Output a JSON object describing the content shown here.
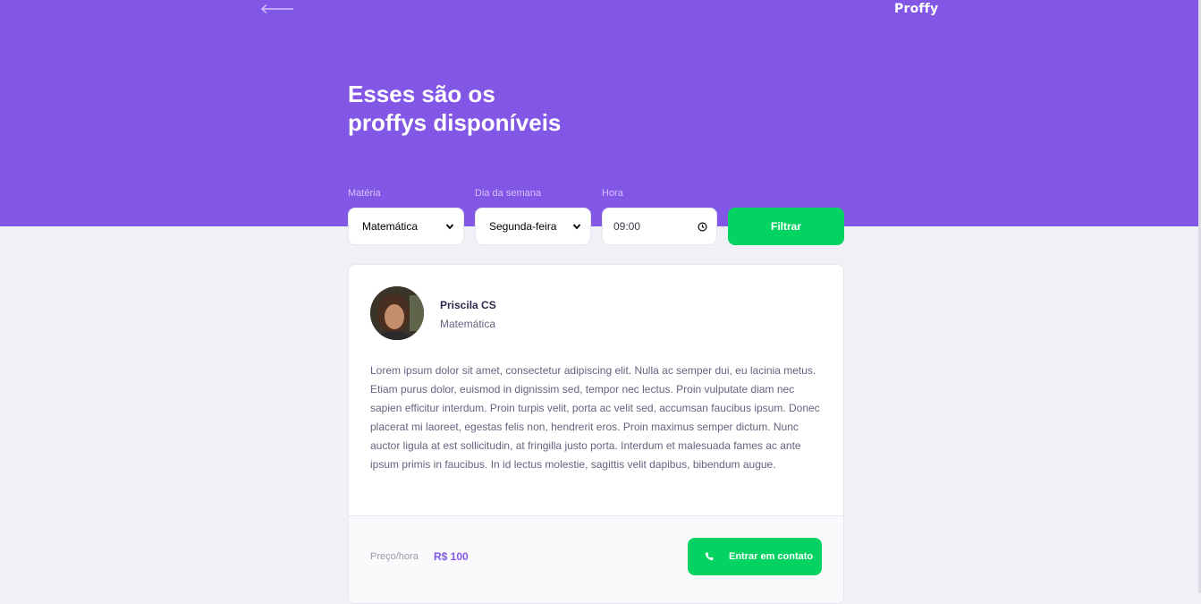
{
  "header": {
    "logo": "Proffy",
    "title_line1": "Esses são os",
    "title_line2": "proffys disponíveis"
  },
  "filters": {
    "subject_label": "Matéria",
    "subject_value": "Matemática",
    "weekday_label": "Dia da semana",
    "weekday_value": "Segunda-feira",
    "time_label": "Hora",
    "time_value": "09:00",
    "filter_button": "Filtrar"
  },
  "teacher": {
    "name": "Priscila CS",
    "subject": "Matemática",
    "bio": "Lorem ipsum dolor sit amet, consectetur adipiscing elit. Nulla ac semper dui, eu lacinia metus. Etiam purus dolor, euismod in dignissim sed, tempor nec lectus. Proin vulputate diam nec sapien efficitur interdum. Proin turpis velit, porta ac velit sed, accumsan faucibus ipsum. Donec placerat mi laoreet, egestas felis non, hendrerit eros. Proin maximus semper dictum. Nunc auctor ligula at est sollicitudin, at fringilla justo porta. Interdum et malesuada fames ac ante ipsum primis in faucibus. In id lectus molestie, sagittis velit dapibus, bibendum augue.",
    "price_label": "Preço/hora",
    "price_value": "R$ 100",
    "contact_button": "Entrar em contato"
  },
  "colors": {
    "primary": "#8257e5",
    "secondary": "#04d361",
    "background": "#f0f0f7"
  }
}
